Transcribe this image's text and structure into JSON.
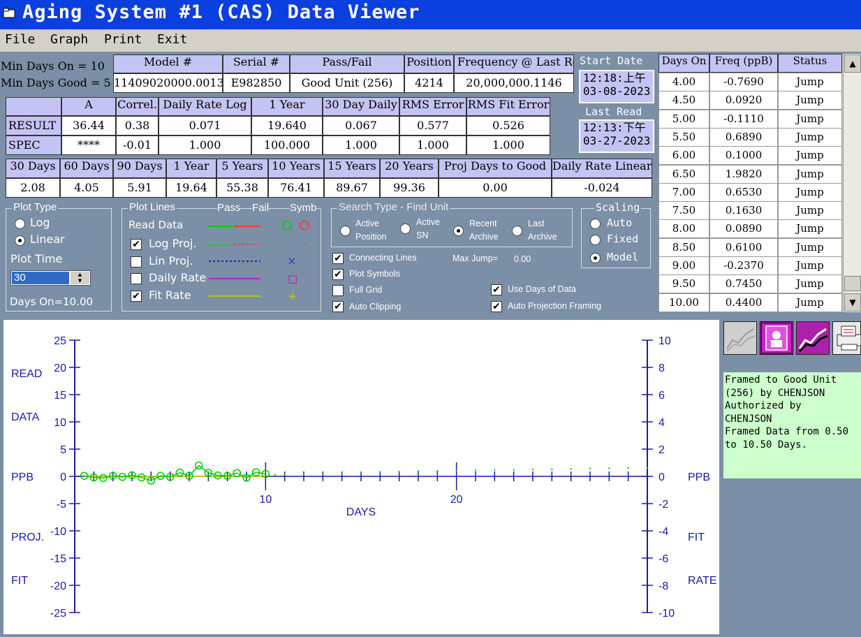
{
  "window": {
    "title": "Aging System #1 (CAS) Data Viewer",
    "icon": "folder-icon"
  },
  "menu": [
    "File",
    "Graph",
    "Print",
    "Exit"
  ],
  "limits": {
    "min_days_on": "Min Days On = 10",
    "min_days_good": "Min Days Good = 5"
  },
  "unit_info": {
    "headers": [
      "Model #",
      "Serial #",
      "Pass/Fail",
      "Position",
      "Frequency @ Last Rea"
    ],
    "values": [
      "11409020000.0013",
      "E982850",
      "Good Unit (256)",
      "4214",
      "20,000,000.1146"
    ]
  },
  "dates": {
    "start_label": "Start Date",
    "start_time": "12:18:上午",
    "start_date": "03-08-2023",
    "last_label": "Last Read",
    "last_time": "12:13:下午",
    "last_date": "03-27-2023"
  },
  "results": {
    "headers": [
      "",
      "A",
      "Correl.",
      "Daily Rate Log",
      "1 Year",
      "30 Day Daily",
      "RMS Error",
      "RMS Fit Error"
    ],
    "rows": [
      [
        "RESULT",
        "36.44",
        "0.38",
        "0.071",
        "19.640",
        "0.067",
        "0.577",
        "0.526"
      ],
      [
        "SPEC",
        "****",
        "-0.01",
        "1.000",
        "100.000",
        "1.000",
        "1.000",
        "1.000"
      ]
    ]
  },
  "projections": {
    "headers": [
      "30 Days",
      "60 Days",
      "90 Days",
      "1 Year",
      "5 Years",
      "10 Years",
      "15 Years",
      "20 Years",
      "Proj Days to Good",
      "Daily Rate Linear"
    ],
    "values": [
      "2.08",
      "4.05",
      "5.91",
      "19.64",
      "55.38",
      "76.41",
      "89.67",
      "99.36",
      "0.00",
      "-0.024"
    ]
  },
  "plot_type": {
    "label": "Plot Type",
    "options": [
      "Log",
      "Linear"
    ],
    "selected": "Linear",
    "plot_time_label": "Plot Time",
    "plot_time_value": "30",
    "days_on": "Days On=10.00"
  },
  "plot_lines": {
    "label": "Plot Lines",
    "pass": "Pass",
    "fail": "Fail",
    "symb": "Symb",
    "read_data": "Read Data",
    "items": [
      {
        "label": "Log Proj.",
        "checked": true,
        "pass_color": "#00cc00",
        "fail_color": "#ff3333",
        "symbol": "·"
      },
      {
        "label": "Lin Proj.",
        "checked": false,
        "pass_color": "#0000cc",
        "fail_color": "#0000cc",
        "symbol": "×"
      },
      {
        "label": "Daily Rate",
        "checked": false,
        "pass_color": "#cc00cc",
        "fail_color": "#cc00cc",
        "symbol": "□"
      },
      {
        "label": "Fit Rate",
        "checked": true,
        "pass_color": "#cccc00",
        "fail_color": "#cccc00",
        "symbol": "+"
      }
    ]
  },
  "search_type": {
    "label": "Search Type - Find Unit",
    "options": [
      [
        "Active",
        "Position"
      ],
      [
        "Active",
        "SN"
      ],
      [
        "Recent",
        "Archive"
      ],
      [
        "Last",
        "Archive"
      ]
    ],
    "selected": 2
  },
  "options": {
    "connecting_lines": "Connecting Lines",
    "plot_symbols": "Plot Symbols",
    "full_grid": "Full Grid",
    "auto_clipping": "Auto Clipping",
    "max_jump_label": "Max Jump=",
    "max_jump_value": "0.00",
    "use_days": "Use Days of Data",
    "auto_projection": "Auto Projection Framing",
    "checked": {
      "connecting_lines": true,
      "plot_symbols": true,
      "full_grid": false,
      "auto_clipping": true,
      "use_days": true,
      "auto_projection": true
    }
  },
  "scaling": {
    "label": "Scaling",
    "options": [
      "Auto",
      "Fixed",
      "Model"
    ],
    "selected": "Model"
  },
  "data_table": {
    "headers": [
      "Days On",
      "Freq (ppB)",
      "Status"
    ],
    "rows": [
      [
        "4.00",
        "-0.7690",
        "Jump"
      ],
      [
        "4.50",
        "0.0920",
        "Jump"
      ],
      [
        "5.00",
        "-0.1110",
        "Jump"
      ],
      [
        "5.50",
        "0.6890",
        "Jump"
      ],
      [
        "6.00",
        "0.1000",
        "Jump"
      ],
      [
        "6.50",
        "1.9820",
        "Jump"
      ],
      [
        "7.00",
        "0.6530",
        "Jump"
      ],
      [
        "7.50",
        "0.1630",
        "Jump"
      ],
      [
        "8.00",
        "0.0890",
        "Jump"
      ],
      [
        "8.50",
        "0.6100",
        "Jump"
      ],
      [
        "9.00",
        "-0.2370",
        "Jump"
      ],
      [
        "9.50",
        "0.7450",
        "Jump"
      ],
      [
        "10.00",
        "0.4400",
        "Jump"
      ]
    ]
  },
  "toolbar_icons": [
    "trend-gray-icon",
    "person-stamp-icon",
    "trend-purple-icon",
    "printer-icon"
  ],
  "notes": {
    "lines": [
      "Framed to Good Unit",
      "(256) by CHENJSON",
      "Authorized by",
      "CHENJSON",
      "Framed Data from 0.50",
      "to 10.50 Days."
    ]
  },
  "chart_data": {
    "type": "scatter",
    "left_axis_labels": [
      "READ",
      "DATA",
      "PPB",
      "PROJ.",
      "FIT"
    ],
    "right_axis_labels": [
      "PPB",
      "FIT",
      "RATE"
    ],
    "xlabel": "DAYS",
    "xlim": [
      0,
      30
    ],
    "x_ticks": [
      10,
      20
    ],
    "ylim_left": [
      -25,
      25
    ],
    "y_ticks_left": [
      25,
      20,
      15,
      10,
      5,
      0,
      -5,
      -10,
      -15,
      -20,
      -25
    ],
    "ylim_right": [
      -10,
      10
    ],
    "y_ticks_right": [
      10,
      8,
      6,
      4,
      2,
      0,
      -2,
      -4,
      -6,
      -8,
      -10
    ],
    "series": [
      {
        "name": "Read Data",
        "color": "#00cc00",
        "x": [
          0.5,
          1.0,
          1.5,
          2.0,
          2.5,
          3.0,
          3.5,
          4.0,
          4.5,
          5.0,
          5.5,
          6.0,
          6.5,
          7.0,
          7.5,
          8.0,
          8.5,
          9.0,
          9.5,
          10.0
        ],
        "y": [
          0.1,
          -0.2,
          -0.3,
          0.1,
          -0.1,
          0.2,
          -0.2,
          -0.769,
          0.092,
          -0.111,
          0.689,
          0.1,
          1.982,
          0.653,
          0.163,
          0.089,
          0.61,
          -0.237,
          0.745,
          0.44
        ]
      },
      {
        "name": "Log Proj.",
        "color": "#00cc00",
        "x": [
          10.5,
          11,
          12,
          13,
          14,
          15,
          16,
          17,
          18,
          19,
          20,
          21,
          22,
          23,
          24,
          25,
          26,
          27,
          28,
          29,
          30
        ],
        "y": [
          0.3,
          0.35,
          0.45,
          0.55,
          0.65,
          0.72,
          0.8,
          0.87,
          0.93,
          1.0,
          1.06,
          1.12,
          1.18,
          1.23,
          1.28,
          1.33,
          1.38,
          1.43,
          1.48,
          1.52,
          1.56
        ]
      },
      {
        "name": "Fit Rate",
        "color": "#cccc00",
        "x": [
          0.5,
          10.0
        ],
        "y": [
          0.0,
          0.0
        ]
      }
    ]
  }
}
